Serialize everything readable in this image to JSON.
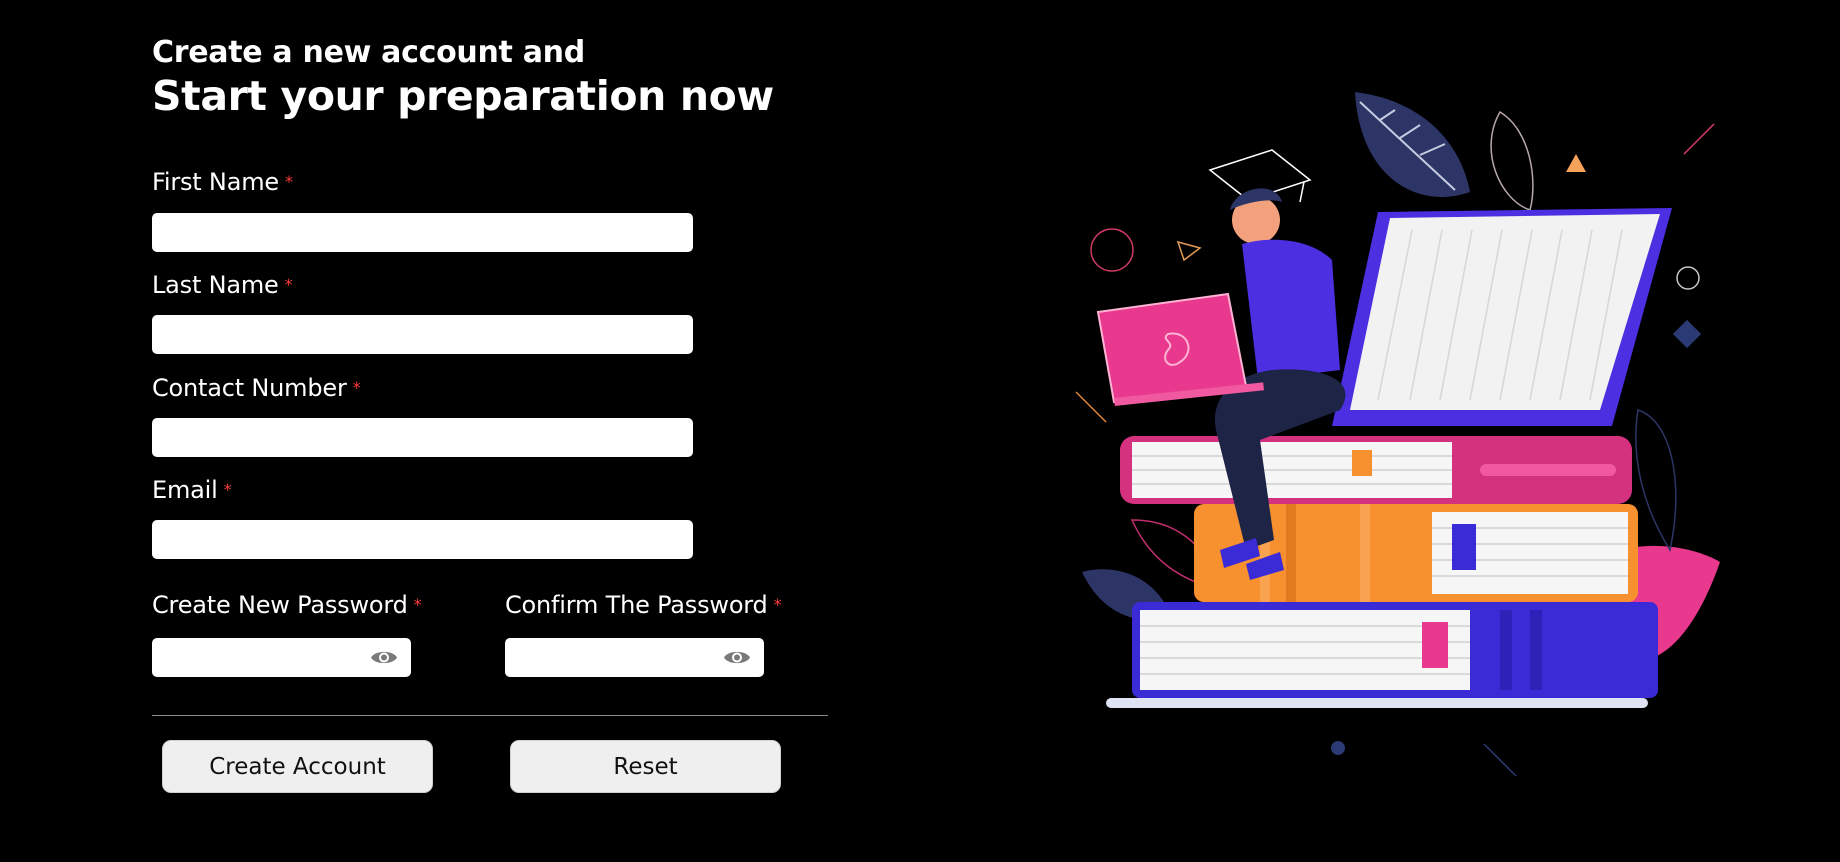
{
  "header": {
    "subtitle": "Create a new account and",
    "title": "Start your preparation now"
  },
  "form": {
    "required_marker": "*",
    "first_name": {
      "label": "First Name",
      "value": ""
    },
    "last_name": {
      "label": "Last Name",
      "value": ""
    },
    "contact_number": {
      "label": "Contact Number",
      "value": ""
    },
    "email": {
      "label": "Email",
      "value": ""
    },
    "new_password": {
      "label": "Create New Password",
      "value": "",
      "icon": "eye-icon"
    },
    "confirm_password": {
      "label": "Confirm The Password",
      "value": "",
      "icon": "eye-icon"
    }
  },
  "actions": {
    "create_label": "Create Account",
    "reset_label": "Reset"
  },
  "colors": {
    "background": "#000000",
    "required": "#ff3b3b",
    "button_bg": "#efefef",
    "accent_purple": "#4b2fe0",
    "accent_pink": "#e8398f",
    "accent_orange": "#f7902f"
  }
}
